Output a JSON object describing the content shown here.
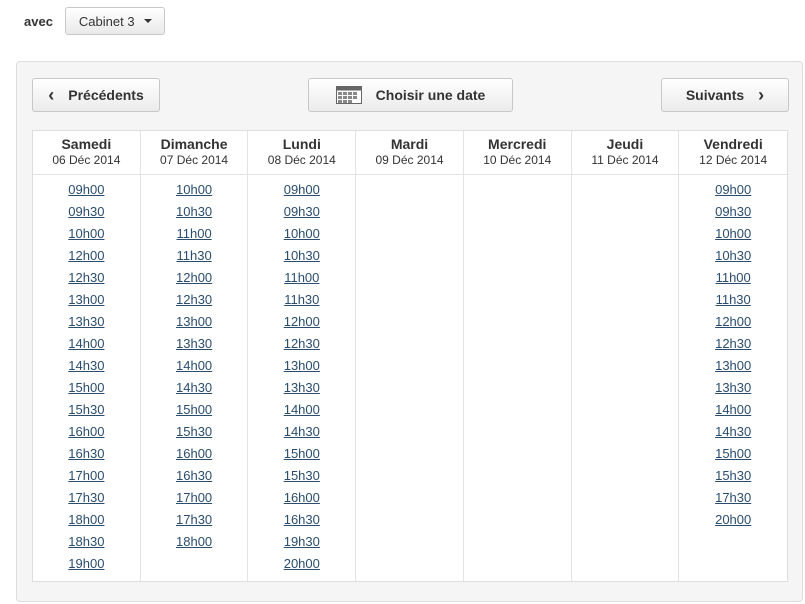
{
  "header": {
    "avec_label": "avec",
    "cabinet_value": "Cabinet 3"
  },
  "nav": {
    "prev_label": "Précédents",
    "date_label": "Choisir une date",
    "next_label": "Suivants",
    "prev_icon": "chevron-left-icon",
    "date_icon": "calendar-icon",
    "next_icon": "chevron-right-icon"
  },
  "colors": {
    "link": "#2a4d6e",
    "panel_bg": "#f5f5f5",
    "border": "#dddddd"
  },
  "days": [
    {
      "name": "Samedi",
      "date": "06 Déc 2014",
      "slots": [
        "09h00",
        "09h30",
        "10h00",
        "12h00",
        "12h30",
        "13h00",
        "13h30",
        "14h00",
        "14h30",
        "15h00",
        "15h30",
        "16h00",
        "16h30",
        "17h00",
        "17h30",
        "18h00",
        "18h30",
        "19h00"
      ]
    },
    {
      "name": "Dimanche",
      "date": "07 Déc 2014",
      "slots": [
        "10h00",
        "10h30",
        "11h00",
        "11h30",
        "12h00",
        "12h30",
        "13h00",
        "13h30",
        "14h00",
        "14h30",
        "15h00",
        "15h30",
        "16h00",
        "16h30",
        "17h00",
        "17h30",
        "18h00"
      ]
    },
    {
      "name": "Lundi",
      "date": "08 Déc 2014",
      "slots": [
        "09h00",
        "09h30",
        "10h00",
        "10h30",
        "11h00",
        "11h30",
        "12h00",
        "12h30",
        "13h00",
        "13h30",
        "14h00",
        "14h30",
        "15h00",
        "15h30",
        "16h00",
        "16h30",
        "19h30",
        "20h00"
      ]
    },
    {
      "name": "Mardi",
      "date": "09 Déc 2014",
      "slots": []
    },
    {
      "name": "Mercredi",
      "date": "10 Déc 2014",
      "slots": []
    },
    {
      "name": "Jeudi",
      "date": "11 Déc 2014",
      "slots": []
    },
    {
      "name": "Vendredi",
      "date": "12 Déc 2014",
      "slots": [
        "09h00",
        "09h30",
        "10h00",
        "10h30",
        "11h00",
        "11h30",
        "12h00",
        "12h30",
        "13h00",
        "13h30",
        "14h00",
        "14h30",
        "15h00",
        "15h30",
        "17h30",
        "20h00"
      ]
    }
  ]
}
